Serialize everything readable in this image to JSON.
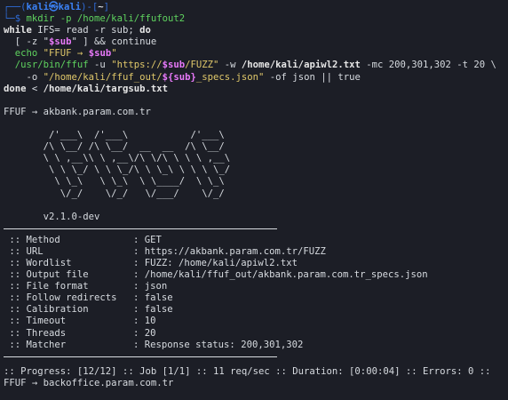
{
  "terminal": {
    "prompt": {
      "frame_top": "┌──(",
      "user": "kali",
      "at": "㉿",
      "host": "kali",
      "frame_mid": ")-[",
      "cwd": "~",
      "frame_end": "]",
      "frame_bottom": "└─$ "
    },
    "cmd_line1": "mkdir -p /home/kali/ffufout2",
    "loop_line": {
      "kw1": "while",
      "rest1": " IFS= read -r sub; ",
      "kw2": "do"
    },
    "cond_line": {
      "part1": "  [ -z \"",
      "var": "$sub",
      "part2": "\" ] && continue"
    },
    "echo_line": {
      "cmd": "  echo",
      "str": " \"FFUF → ",
      "var": "$sub",
      "end": "\""
    },
    "ffuf_line1": {
      "cmd": "  /usr/bin/ffuf",
      "flag_u": " -u ",
      "q1": "\"https://",
      "var1": "$sub",
      "q1b": "/FUZZ\"",
      "flag_w": " -w ",
      "path_w": "/home/kali/apiwl2.txt",
      "rest": " -mc 200,301,302 -t 20 \\"
    },
    "ffuf_line2": {
      "flag_o": "    -o ",
      "q2": "\"/home/kali/ffuf_out/",
      "var2": "${sub}",
      "q2b": "_specs.json\"",
      "rest": " -of json || true"
    },
    "done_line": {
      "kw": "done",
      "rest": " < ",
      "path": "/home/kali/targsub.txt"
    },
    "ffuf_target1": "FFUF → akbank.param.com.tr",
    "banner": [
      "        /'___\\  /'___\\           /'___\\",
      "       /\\ \\__/ /\\ \\__/  __  __  /\\ \\__/",
      "       \\ \\ ,__\\\\ \\ ,__\\/\\ \\/\\ \\ \\ \\ ,__\\",
      "        \\ \\ \\_/ \\ \\ \\_/\\ \\ \\_\\ \\ \\ \\ \\_/",
      "         \\ \\_\\   \\ \\_\\  \\ \\____/  \\ \\_\\",
      "          \\/_/    \\/_/   \\/___/    \\/_/"
    ],
    "version": "       v2.1.0-dev",
    "config": [
      {
        "key": " :: Method",
        "value": "GET"
      },
      {
        "key": " :: URL",
        "value": "https://akbank.param.com.tr/FUZZ"
      },
      {
        "key": " :: Wordlist",
        "value": "FUZZ: /home/kali/apiwl2.txt"
      },
      {
        "key": " :: Output file",
        "value": "/home/kali/ffuf_out/akbank.param.com.tr_specs.json"
      },
      {
        "key": " :: File format",
        "value": "json"
      },
      {
        "key": " :: Follow redirects",
        "value": "false"
      },
      {
        "key": " :: Calibration",
        "value": "false"
      },
      {
        "key": " :: Timeout",
        "value": "10"
      },
      {
        "key": " :: Threads",
        "value": "20"
      },
      {
        "key": " :: Matcher",
        "value": "Response status: 200,301,302"
      }
    ],
    "sep": ": ",
    "progress": ":: Progress: [12/12] :: Job [1/1] :: 11 req/sec :: Duration: [0:00:04] :: Errors: 0 ::",
    "ffuf_target2": "FFUF → backoffice.param.com.tr"
  }
}
